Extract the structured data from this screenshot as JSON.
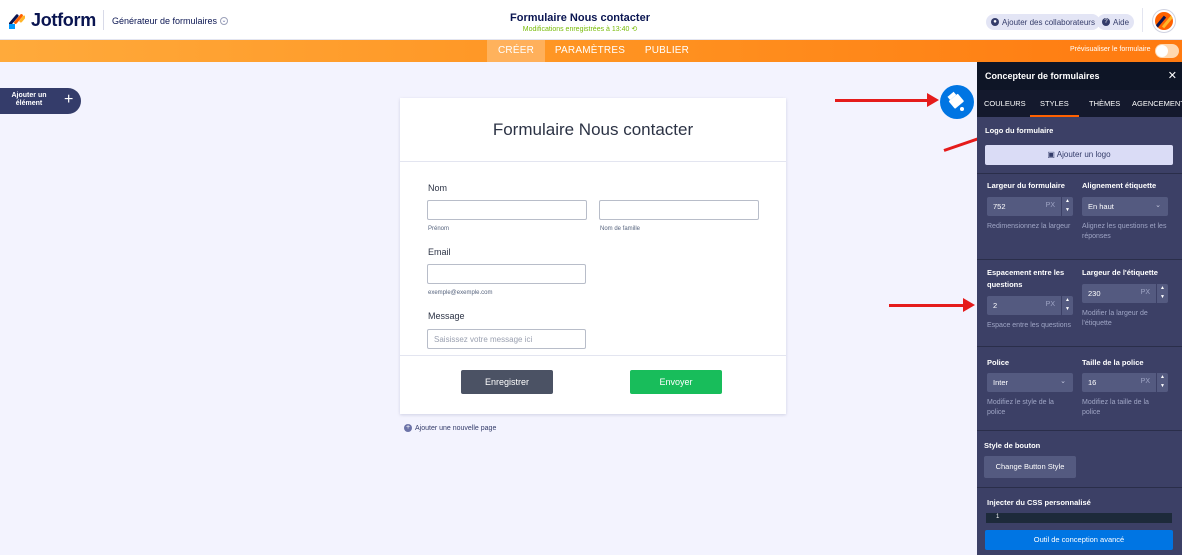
{
  "app": {
    "logo_text": "Jotform",
    "builder_label": "Générateur de formulaires",
    "form_title": "Formulaire Nous contacter",
    "saved_status": "Modifications enregistrées à 13:40",
    "collaborators_label": "Ajouter des collaborateurs",
    "help_label": "Aide"
  },
  "nav": {
    "tabs": [
      "CRÉER",
      "PARAMÈTRES",
      "PUBLIER"
    ],
    "active_tab": "CRÉER",
    "preview_label": "Prévisualiser le formulaire",
    "preview_enabled": false
  },
  "left": {
    "add_element_label": "Ajouter un élément",
    "add_element_icon": "plus-icon"
  },
  "form": {
    "title": "Formulaire Nous contacter",
    "name_label": "Nom",
    "first_name_sub": "Prénom",
    "last_name_sub": "Nom de famille",
    "email_label": "Email",
    "email_sub": "exemple@exemple.com",
    "message_label": "Message",
    "message_placeholder": "Saisissez votre message ici",
    "save_button": "Enregistrer",
    "send_button": "Envoyer",
    "add_page": "Ajouter une nouvelle page"
  },
  "panel": {
    "title": "Concepteur de formulaires",
    "tabs": [
      "COULEURS",
      "STYLES",
      "THÈMES",
      "AGENCEMENT"
    ],
    "active_tab": "STYLES",
    "logo_section_label": "Logo du formulaire",
    "logo_button": "Ajouter un logo",
    "form_width_label": "Largeur du formulaire",
    "form_width_value": "752",
    "form_width_unit": "PX",
    "form_width_desc": "Redimensionnez la largeur",
    "label_align_label": "Alignement étiquette",
    "label_align_value": "En haut",
    "label_align_desc": "Alignez les questions et les réponses",
    "question_spacing_label": "Espacement entre les questions",
    "question_spacing_value": "2",
    "question_spacing_unit": "PX",
    "question_spacing_desc": "Espace entre les questions",
    "label_width_label": "Largeur de l'étiquette",
    "label_width_value": "230",
    "label_width_unit": "PX",
    "label_width_desc": "Modifier la largeur de l'étiquette",
    "font_label": "Police",
    "font_value": "Inter",
    "font_desc": "Modifiez le style de la police",
    "font_size_label": "Taille de la police",
    "font_size_value": "16",
    "font_size_unit": "PX",
    "font_size_desc": "Modifiez la taille de la police",
    "button_style_label": "Style de bouton",
    "button_style_button": "Change Button Style",
    "custom_css_label": "Injecter du CSS personnalisé",
    "custom_css_line": "1",
    "advanced_button": "Outil de conception avancé"
  },
  "colors": {
    "accent_orange": "#ff6100",
    "brand_navy": "#0a1551",
    "panel_bg": "#3c4066",
    "send_green": "#18bd5b",
    "designer_blue": "#0075e3",
    "arrow_red": "#e51b1b"
  }
}
